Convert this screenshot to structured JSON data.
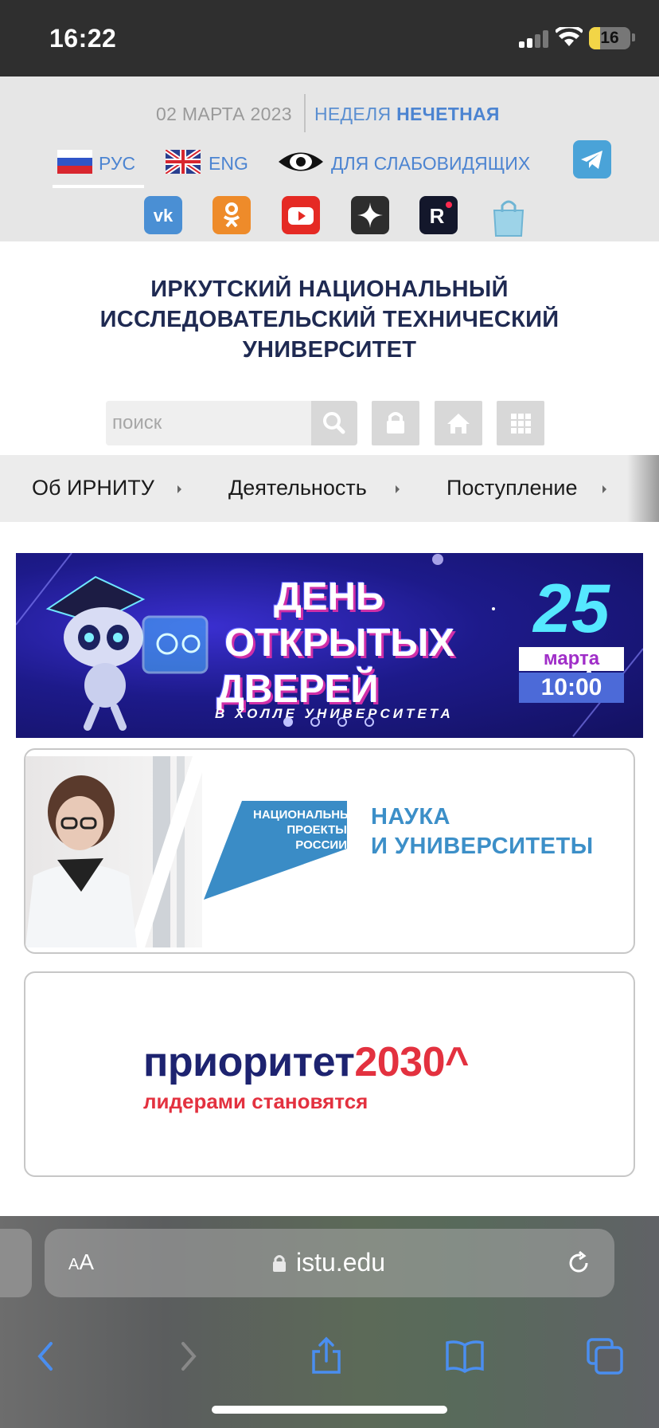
{
  "status_bar": {
    "time": "16:22",
    "battery": "16"
  },
  "header": {
    "date": "02 МАРТА 2023",
    "week_label": "НЕДЕЛЯ",
    "week_value": "НЕЧЕТНАЯ",
    "languages": [
      {
        "label": "РУС",
        "active": true
      },
      {
        "label": "ENG",
        "active": false
      }
    ],
    "accessibility_label": "ДЛЯ СЛАБОВИДЯЩИХ",
    "social_icons": [
      "vk-icon",
      "odnoklassniki-icon",
      "youtube-icon",
      "zen-icon",
      "rutube-icon",
      "shop-bag-icon"
    ],
    "telegram_icon": "telegram-icon"
  },
  "university": {
    "title_line1": "ИРКУТСКИЙ НАЦИОНАЛЬНЫЙ",
    "title_line2": "ИССЛЕДОВАТЕЛЬСКИЙ ТЕХНИЧЕСКИЙ",
    "title_line3": "УНИВЕРСИТЕТ"
  },
  "search": {
    "placeholder": "поиск"
  },
  "nav": {
    "items": [
      "Об ИРНИТУ",
      "Деятельность",
      "Поступление"
    ]
  },
  "banner": {
    "line1": "ДЕНЬ",
    "line2": "ОТКРЫТЫХ",
    "line3": "ДВЕРЕЙ",
    "subtitle": "В ХОЛЛЕ УНИВЕРСИТЕТА",
    "day": "25",
    "month": "марта",
    "time": "10:00",
    "slides": 4,
    "active_slide": 1
  },
  "cards": {
    "national_projects": {
      "logo_lines": [
        "НАЦИОНАЛЬНЫЕ",
        "ПРОЕКТЫ",
        "РОССИИ"
      ],
      "title_line1": "НАУКА",
      "title_line2": "И УНИВЕРСИТЕТЫ"
    },
    "priority": {
      "word": "приоритет",
      "number": "2030",
      "caret": "^",
      "slogan": "лидерами становятся"
    }
  },
  "browser": {
    "text_size": "AA",
    "url": "istu.edu"
  },
  "colors": {
    "accent_blue": "#4c84d1",
    "title_navy": "#1f2a52",
    "header_grey": "#e6e6e6",
    "priority_red": "#e3313f"
  }
}
